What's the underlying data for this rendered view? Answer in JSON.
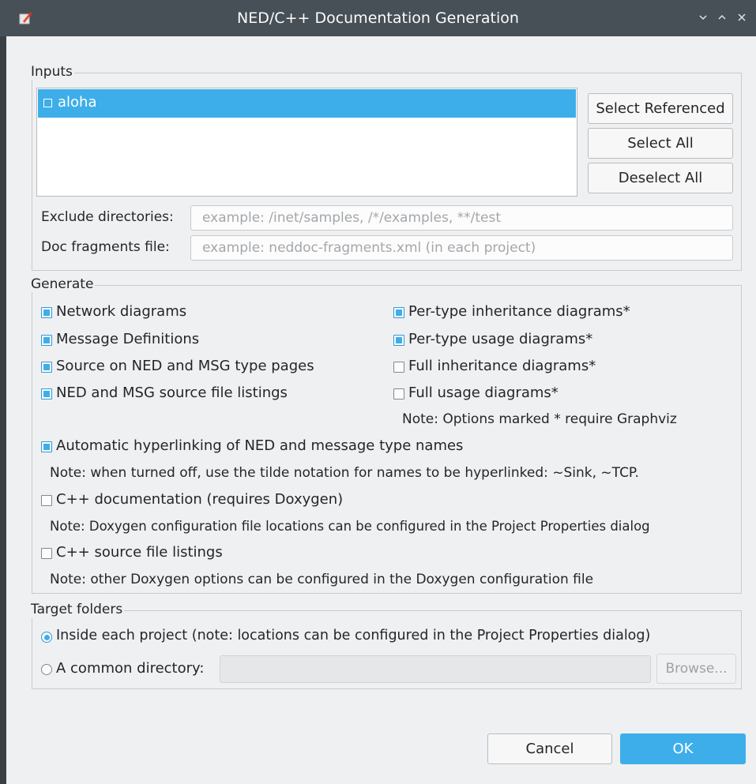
{
  "window": {
    "title": "NED/C++ Documentation Generation"
  },
  "inputs": {
    "group_title": "Inputs",
    "projects": [
      {
        "label": "aloha",
        "checked": false,
        "selected": true
      }
    ],
    "buttons": {
      "select_referenced": "Select Referenced",
      "select_all": "Select All",
      "deselect_all": "Deselect All"
    },
    "exclude_dirs": {
      "label": "Exclude directories:",
      "value": "",
      "placeholder": "example: /inet/samples, /*/examples, **/test"
    },
    "doc_fragments": {
      "label": "Doc fragments file:",
      "value": "",
      "placeholder": "example: neddoc-fragments.xml (in each project)"
    }
  },
  "generate": {
    "group_title": "Generate",
    "options": {
      "network_diagrams": {
        "label": "Network diagrams",
        "checked": true
      },
      "message_definitions": {
        "label": "Message Definitions",
        "checked": true
      },
      "source_on_type_pages": {
        "label": "Source on NED and MSG type pages",
        "checked": true
      },
      "source_listings": {
        "label": "NED and MSG source file listings",
        "checked": true
      },
      "per_type_inheritance": {
        "label": "Per-type inheritance diagrams*",
        "checked": true
      },
      "per_type_usage": {
        "label": "Per-type usage diagrams*",
        "checked": true
      },
      "full_inheritance": {
        "label": "Full inheritance diagrams*",
        "checked": false
      },
      "full_usage": {
        "label": "Full usage diagrams*",
        "checked": false
      },
      "auto_hyperlinking": {
        "label": "Automatic hyperlinking of NED and message type names",
        "checked": true
      },
      "cpp_docs": {
        "label": "C++ documentation (requires Doxygen)",
        "checked": false
      },
      "cpp_source_listings": {
        "label": "C++ source file listings",
        "checked": false
      }
    },
    "notes": {
      "graphviz": "Note: Options marked * require Graphviz",
      "tilde": "Note: when turned off, use the tilde notation for names to be hyperlinked: ~Sink, ~TCP.",
      "doxygen_config": "Note: Doxygen configuration file locations can be configured in the Project Properties dialog",
      "doxygen_options": "Note: other Doxygen options can be configured in the Doxygen configuration file"
    }
  },
  "target": {
    "group_title": "Target folders",
    "inside_project": {
      "label": "Inside each project (note: locations can be configured in the Project Properties dialog)",
      "selected": true
    },
    "common_dir": {
      "label": "A common directory:",
      "selected": false,
      "value": ""
    },
    "browse_label": "Browse..."
  },
  "footer": {
    "cancel_label": "Cancel",
    "ok_label": "OK"
  },
  "colors": {
    "accent": "#3daee9",
    "titlebar": "#475057",
    "window_bg": "#eff0f1"
  }
}
